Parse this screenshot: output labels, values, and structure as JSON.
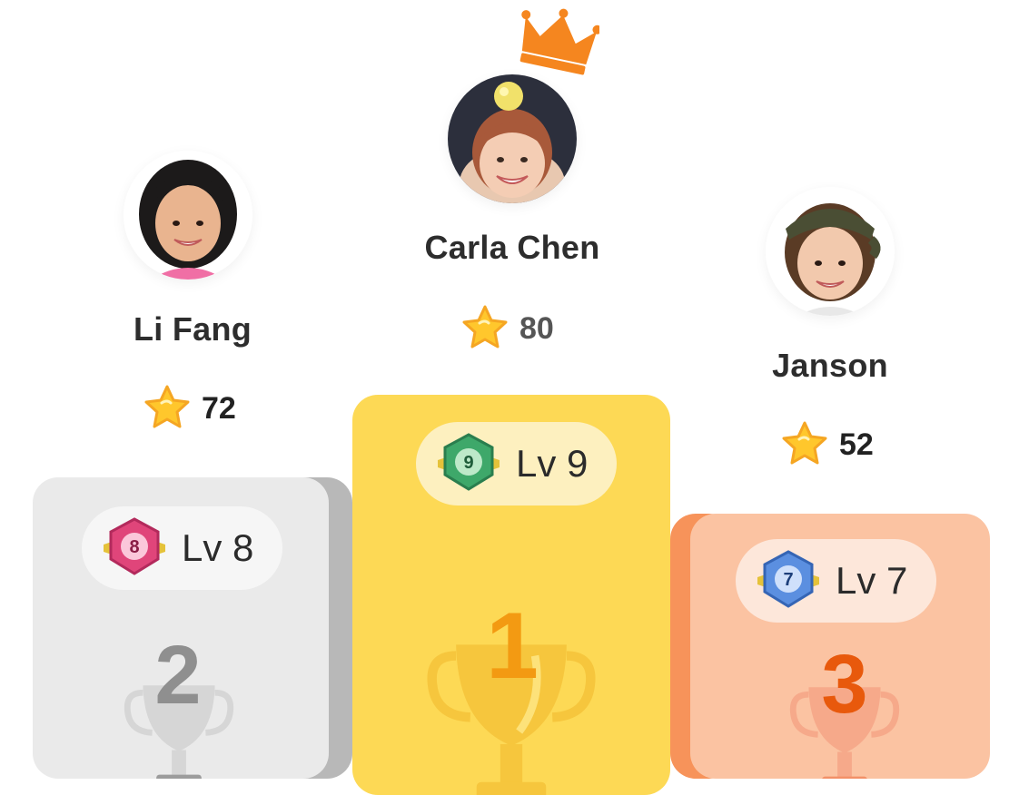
{
  "leaderboard": {
    "first": {
      "name": "Carla Chen",
      "score": "80",
      "level": "Lv 9",
      "badge_number": "9",
      "rank": "1",
      "podium_color": "#fdd955",
      "rank_color": "#f39a12"
    },
    "second": {
      "name": "Li Fang",
      "score": "72",
      "level": "Lv 8",
      "badge_number": "8",
      "rank": "2",
      "podium_color": "#eaeaea",
      "rank_color": "#8f8f8f"
    },
    "third": {
      "name": "Janson",
      "score": "52",
      "level": "Lv 7",
      "badge_number": "7",
      "rank": "3",
      "podium_color": "#fbc3a2",
      "rank_color": "#e8590c"
    }
  },
  "icons": {
    "crown": "crown-icon",
    "star": "star-icon",
    "trophy": "trophy-icon",
    "level_badge": "level-badge-icon"
  },
  "colors": {
    "crown": "#f5861f",
    "star": "#ffc72c"
  }
}
